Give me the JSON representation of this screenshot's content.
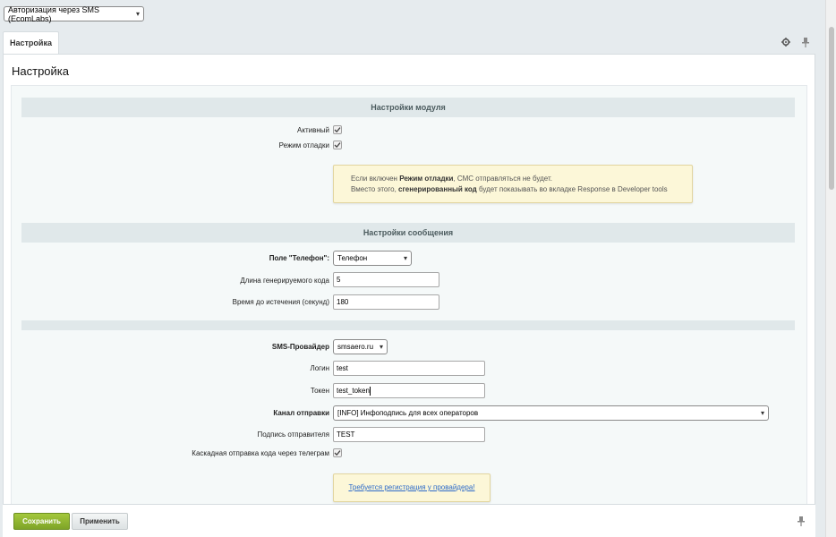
{
  "module_select": {
    "value": "Авторизация через SMS (EcomLabs)"
  },
  "tabs": [
    {
      "label": "Настройка"
    }
  ],
  "page_title": "Настройка",
  "sections": {
    "module": "Настройки модуля",
    "message": "Настройки сообщения"
  },
  "fields": {
    "active_label": "Активный",
    "debug_label": "Режим отладки",
    "phone_label": "Поле \"Телефон\":",
    "phone_value": "Телефон",
    "code_length_label": "Длина генерируемого кода",
    "code_length_value": "5",
    "expiry_label": "Время до истечения (секунд)",
    "expiry_value": "180",
    "provider_label": "SMS-Провайдер",
    "provider_value": "smsaero.ru",
    "login_label": "Логин",
    "login_value": "test",
    "token_label": "Токен",
    "token_value": "test_token",
    "channel_label": "Канал отправки",
    "channel_value": "[INFO] Инфоподпись для всех операторов",
    "sender_label": "Подпись отправителя",
    "sender_value": "TEST",
    "telegram_label": "Каскадная отправка кода через телеграм"
  },
  "debug_note": {
    "line1_pre": "Если включен ",
    "line1_bold": "Режим отладки",
    "line1_post": ", СМС отправляться не будет.",
    "line2_pre": "Вместо этого, ",
    "line2_bold": "сгенерированный код",
    "line2_post": " будет показывать во вкладке Response в Developer tools"
  },
  "provider_note": {
    "link": "Требуется регистрация у провайдера!"
  },
  "footer": {
    "save": "Сохранить",
    "apply": "Применить"
  },
  "colors": {
    "save_green": "#8cb32b",
    "note_bg": "#fcf7d8",
    "section_bg": "#e0e8ea",
    "link": "#2c6ac9"
  }
}
